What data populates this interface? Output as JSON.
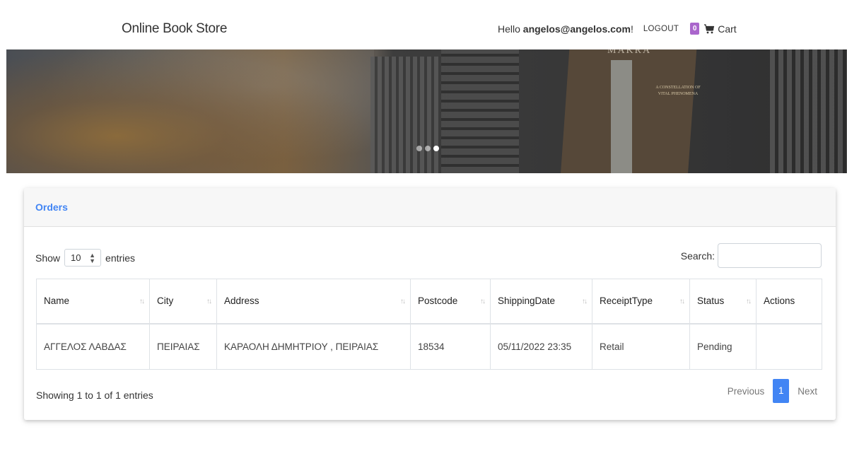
{
  "navbar": {
    "brand": "Online Book Store",
    "hello_prefix": "Hello ",
    "user_email": "angelos@angelos.com",
    "hello_suffix": "!",
    "logout_label": "LOGOUT",
    "cart_count": "0",
    "cart_icon": "shopping-cart-icon",
    "cart_label": "Cart"
  },
  "banner": {
    "book_title": "MAKRA",
    "book_text": "A CONSTELLATION OF VITAL PHENOMENA",
    "slide_count": 3,
    "active_slide": 3
  },
  "orders": {
    "title": "Orders",
    "length": {
      "show_label": "Show",
      "value": "10",
      "entries_label": "entries"
    },
    "search_label": "Search:",
    "search_value": "",
    "columns": [
      "Name",
      "City",
      "Address",
      "Postcode",
      "ShippingDate",
      "ReceiptType",
      "Status",
      "Actions"
    ],
    "rows": [
      {
        "name": "ΑΓΓΕΛΟΣ ΛΑΒΔΑΣ",
        "city": "ΠΕΙΡΑΙΑΣ",
        "address": "ΚΑΡΑΟΛΗ ΔΗΜΗΤΡΙΟΥ , ΠΕΙΡΑΙΑΣ",
        "postcode": "18534",
        "shipping_date": "05/11/2022 23:35",
        "receipt_type": "Retail",
        "status": "Pending",
        "actions": ""
      }
    ],
    "info": "Showing 1 to 1 of 1 entries",
    "pagination": {
      "previous": "Previous",
      "current": "1",
      "next": "Next"
    }
  },
  "colors": {
    "accent": "#4285f4",
    "badge": "#aa66cc"
  }
}
